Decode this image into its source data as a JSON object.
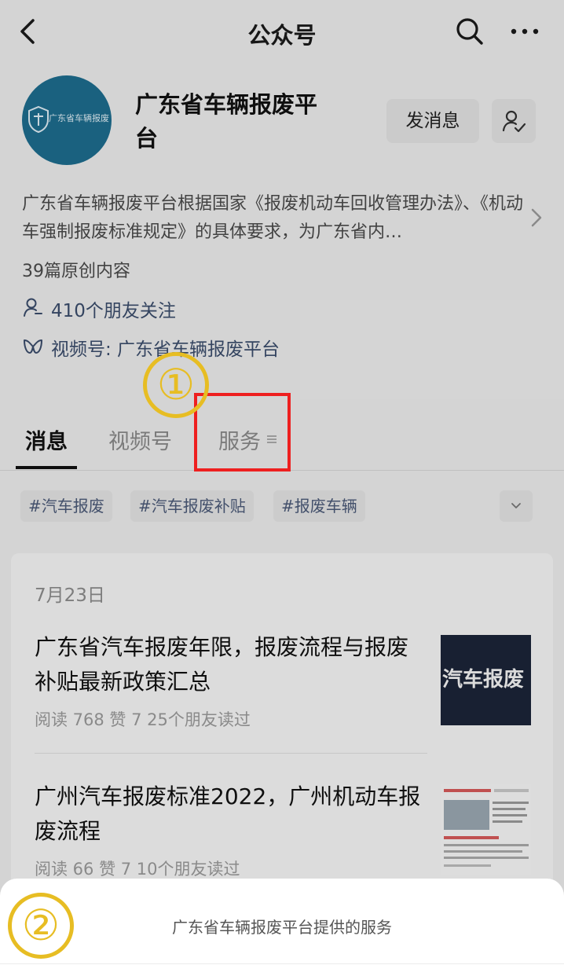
{
  "nav": {
    "title": "公众号"
  },
  "profile": {
    "name": "广东省车辆报废平台",
    "avatar_text": "广东省车辆报废",
    "message_button": "发消息",
    "description": "广东省车辆报废平台根据国家《报废机动车回收管理办法》、《机动车强制报废标准规定》的具体要求，为广东省内…",
    "original_count": "39篇原创内容",
    "friends_following": "410个朋友关注",
    "video_channel": "视频号: 广东省车辆报废平台"
  },
  "annotations": {
    "one": "①",
    "two": "②"
  },
  "tabs": [
    {
      "label": "消息"
    },
    {
      "label": "视频号"
    },
    {
      "label": "服务"
    }
  ],
  "tags": [
    "#汽车报废",
    "#汽车报废补贴",
    "#报废车辆"
  ],
  "feed": {
    "date": "7月23日",
    "articles": [
      {
        "title": "广东省汽车报废年限，报废流程与报废补贴最新政策汇总",
        "meta": "阅读 768  赞 7  25个朋友读过",
        "thumb_text": "汽车报废"
      },
      {
        "title": "广州汽车报废标准2022，广州机动车报废流程",
        "meta": "阅读 66  赞 7  10个朋友读过"
      }
    ]
  },
  "sheet": {
    "title": "广东省车辆报废平台提供的服务"
  },
  "colors": {
    "annotation_yellow": "#e7bd23",
    "highlight_red": "#ee1f1f",
    "link_blue": "#3a4c6b"
  }
}
